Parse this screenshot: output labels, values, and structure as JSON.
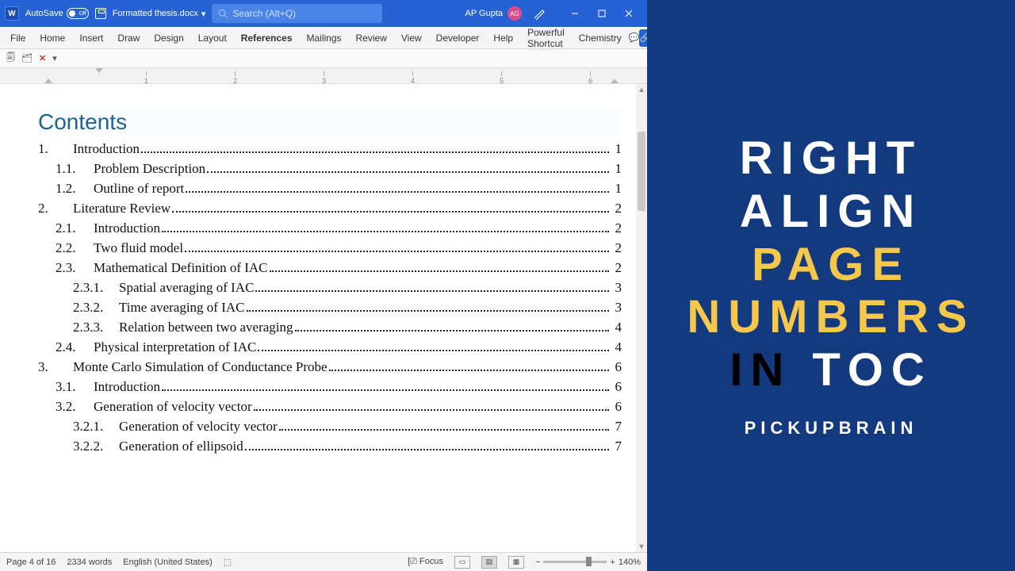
{
  "titlebar": {
    "autosave_label": "AutoSave",
    "autosave_state": "Off",
    "document_name": "Formatted thesis.docx",
    "search_placeholder": "Search (Alt+Q)",
    "user_name": "AP Gupta",
    "user_initials": "AG"
  },
  "menubar": {
    "items": [
      "File",
      "Home",
      "Insert",
      "Draw",
      "Design",
      "Layout",
      "References",
      "Mailings",
      "Review",
      "View",
      "Developer",
      "Help",
      "Powerful Shortcut",
      "Chemistry"
    ],
    "active": "References"
  },
  "ruler_marks": [
    "1",
    "2",
    "3",
    "4",
    "5",
    "6"
  ],
  "toc": {
    "title": "Contents",
    "rows": [
      {
        "level": 1,
        "num": "1.",
        "text": "Introduction",
        "page": "1"
      },
      {
        "level": 2,
        "num": "1.1.",
        "text": "Problem Description",
        "page": "1"
      },
      {
        "level": 2,
        "num": "1.2.",
        "text": "Outline of report",
        "page": "1"
      },
      {
        "level": 1,
        "num": "2.",
        "text": "Literature Review",
        "page": "2"
      },
      {
        "level": 2,
        "num": "2.1.",
        "text": "Introduction",
        "page": "2"
      },
      {
        "level": 2,
        "num": "2.2.",
        "text": "Two fluid model",
        "page": "2"
      },
      {
        "level": 2,
        "num": "2.3.",
        "text": "Mathematical Definition of IAC",
        "page": "2"
      },
      {
        "level": 3,
        "num": "2.3.1.",
        "text": "Spatial averaging of IAC",
        "page": "3"
      },
      {
        "level": 3,
        "num": "2.3.2.",
        "text": "Time averaging of IAC",
        "page": "3"
      },
      {
        "level": 3,
        "num": "2.3.3.",
        "text": "Relation between two averaging",
        "page": "4"
      },
      {
        "level": 2,
        "num": "2.4.",
        "text": "Physical interpretation of IAC",
        "page": "4"
      },
      {
        "level": 1,
        "num": "3.",
        "text": "Monte Carlo Simulation of Conductance Probe",
        "page": "6"
      },
      {
        "level": 2,
        "num": "3.1.",
        "text": "Introduction",
        "page": "6"
      },
      {
        "level": 2,
        "num": "3.2.",
        "text": "Generation of velocity vector",
        "page": "6"
      },
      {
        "level": 3,
        "num": "3.2.1.",
        "text": "Generation of velocity vector",
        "page": "7"
      },
      {
        "level": 3,
        "num": "3.2.2.",
        "text": "Generation of ellipsoid",
        "page": "7"
      }
    ]
  },
  "status": {
    "page": "Page 4 of 16",
    "words": "2334 words",
    "lang": "English (United States)",
    "focus": "Focus",
    "zoom": "140%"
  },
  "promo": {
    "line1a": "RIGHT",
    "line1b": "ALIGN",
    "line2a": "PAGE",
    "line2b": "NUMBERS",
    "line3a": "IN",
    "line3b": "TOC",
    "brand": "PICKUPBRAIN"
  }
}
